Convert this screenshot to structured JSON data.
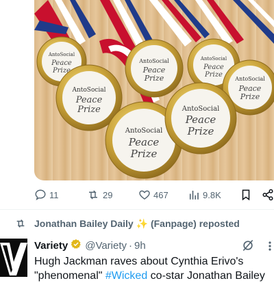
{
  "media": {
    "medals": [
      {
        "brand": "AntoSocial",
        "line1": "Peace",
        "line2": "Prize"
      },
      {
        "brand": "AntoSocial",
        "line1": "Peace",
        "line2": "Prize"
      },
      {
        "brand": "AntoSocial",
        "line1": "Peace",
        "line2": "Prize"
      },
      {
        "brand": "AntoSocial",
        "line1": "Peace",
        "line2": "Prize"
      },
      {
        "brand": "AntoSocial",
        "line1": "Peace",
        "line2": "Prize"
      },
      {
        "brand": "AntoSocial",
        "line1": "Peace",
        "line2": "Prize"
      }
    ]
  },
  "actions": {
    "replies": "11",
    "reposts": "29",
    "likes": "467",
    "views": "9.8K"
  },
  "repost": {
    "by": "Jonathan Bailey Daily",
    "sparkle": "✨",
    "suffix": "(Fanpage) reposted"
  },
  "tweet": {
    "name": "Variety",
    "handle": "@Variety",
    "dot": "·",
    "time": "9h",
    "line1": "Hugh Jackman raves about Cynthia Erivo's",
    "line2_pre": "\"phenomenal\" ",
    "hashtag": "#Wicked",
    "line2_post": " co-star Jonathan Bailey"
  },
  "colors": {
    "muted": "#536471",
    "link": "#1d9bf0",
    "verified": "#e2b719",
    "divider": "#eff3f4"
  },
  "icons": [
    "reply-icon",
    "repost-icon",
    "like-icon",
    "views-icon",
    "bookmark-icon",
    "share-icon",
    "grok-icon",
    "more-icon",
    "verified-icon"
  ]
}
